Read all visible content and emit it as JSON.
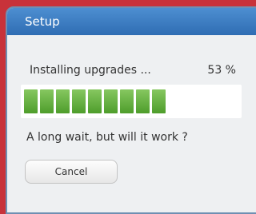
{
  "window": {
    "title": "Setup"
  },
  "progress": {
    "status_text": "Installing upgrades ...",
    "percent_text": "53 %",
    "value": 0.53,
    "block_count": 9,
    "fill_color": "#5fb63a"
  },
  "message": "A long wait, but will it work ?",
  "buttons": {
    "cancel_label": "Cancel"
  },
  "colors": {
    "background": "#c8323a",
    "title_bar": "#3f82c6",
    "dialog_body": "#eef0f2"
  }
}
